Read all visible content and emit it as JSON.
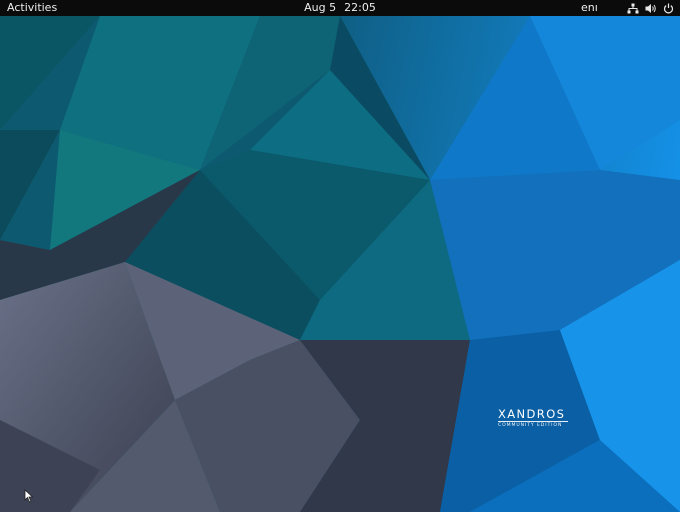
{
  "topbar": {
    "activities_label": "Activities",
    "date": "Aug 5",
    "time": "22:05",
    "language": "enı"
  },
  "tray": {
    "icons": [
      "network-icon",
      "volume-icon",
      "power-icon"
    ]
  },
  "desktop": {
    "brand_name": "XANDROS",
    "brand_subtitle": "COMMUNITY EDITION"
  },
  "colors": {
    "topbar_bg": "#0b0b0b",
    "teal": "#0e6d7d",
    "blue": "#1180d8",
    "slate": "#555c70"
  }
}
